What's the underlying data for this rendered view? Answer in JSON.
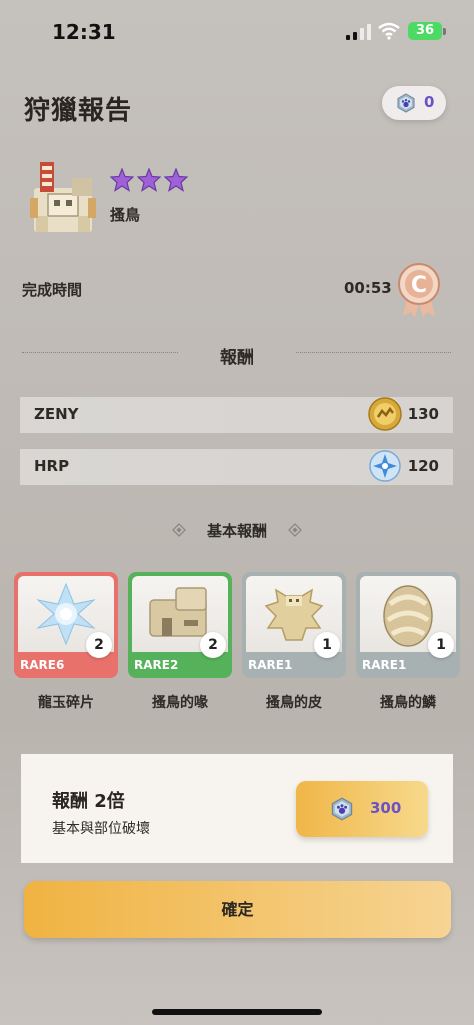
{
  "status_bar": {
    "time": "12:31",
    "battery": "36"
  },
  "header": {
    "title": "狩獵報告",
    "currency_value": "0"
  },
  "monster": {
    "name": "搔鳥",
    "stars": 3
  },
  "clear_time": {
    "label": "完成時間",
    "value": "00:53",
    "rank": "C"
  },
  "rewards": {
    "title": "報酬",
    "rows": [
      {
        "label": "ZENY",
        "value": "130",
        "icon": "zeny-coin-icon"
      },
      {
        "label": "HRP",
        "value": "120",
        "icon": "hrp-crystal-icon"
      }
    ],
    "basic_title": "基本報酬",
    "items": [
      {
        "name": "龍玉碎片",
        "rarity": "RARE6",
        "count": "2",
        "color": "#e8716b"
      },
      {
        "name": "搔鳥的喙",
        "rarity": "RARE2",
        "count": "2",
        "color": "#55b25a"
      },
      {
        "name": "搔鳥的皮",
        "rarity": "RARE1",
        "count": "1",
        "color": "#a7b1b2"
      },
      {
        "name": "搔鳥的鱗",
        "rarity": "RARE1",
        "count": "1",
        "color": "#a7b1b2"
      }
    ]
  },
  "double_reward": {
    "title": "報酬 2倍",
    "subtitle": "基本與部位破壞",
    "cost": "300"
  },
  "confirm_label": "確定",
  "colors": {
    "accent_gold": "#f0b342",
    "paw_purple": "#6b52c7"
  }
}
